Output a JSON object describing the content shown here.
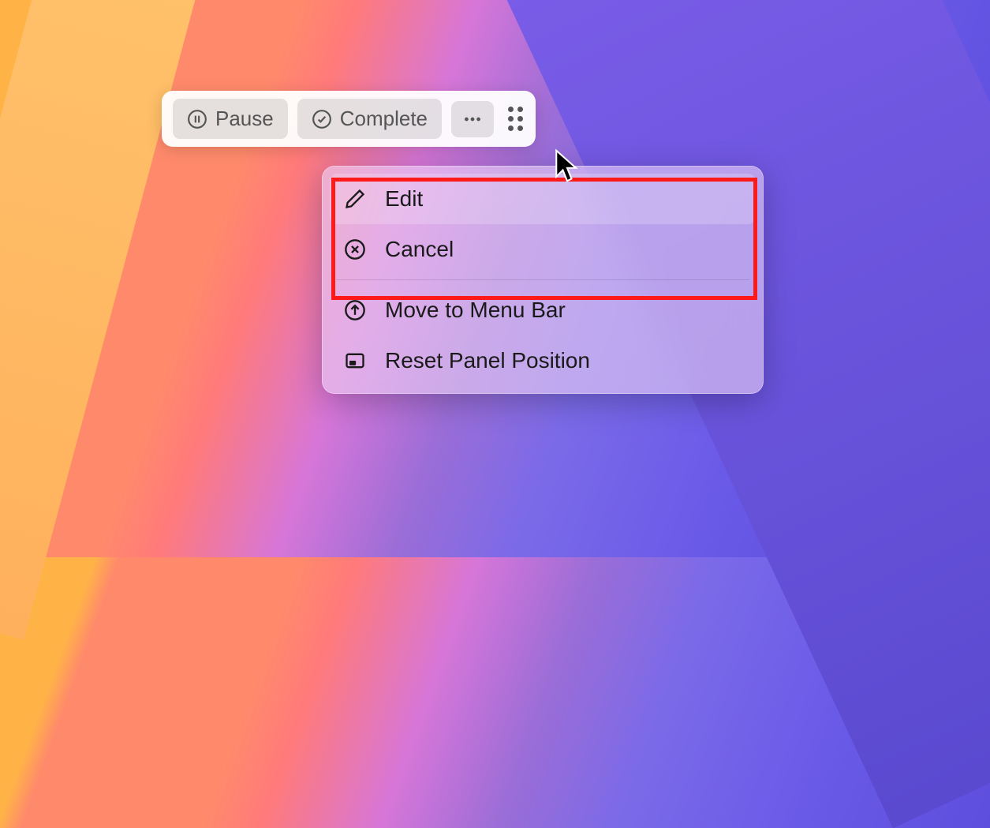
{
  "toolbar": {
    "pause_label": "Pause",
    "complete_label": "Complete"
  },
  "menu": {
    "edit_label": "Edit",
    "cancel_label": "Cancel",
    "move_label": "Move to Menu Bar",
    "reset_label": "Reset Panel Position"
  }
}
